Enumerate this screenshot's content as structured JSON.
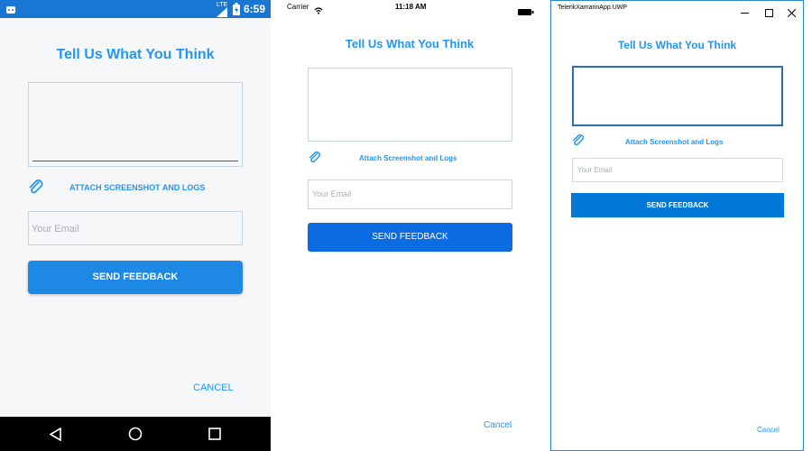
{
  "android": {
    "status": {
      "lte": "LTE",
      "time": "6:59"
    },
    "title": "Tell Us What You Think",
    "attach_label": "ATTACH SCREENSHOT AND LOGS",
    "email_placeholder": "Your Email",
    "send_label": "SEND FEEDBACK",
    "cancel_label": "CANCEL"
  },
  "ios": {
    "status": {
      "carrier": "Carrier",
      "time": "11:18 AM"
    },
    "title": "Tell Us What You Think",
    "attach_label": "Attach Screenshot and Logs",
    "email_placeholder": "Your Email",
    "send_label": "SEND FEEDBACK",
    "cancel_label": "Cancel"
  },
  "uwp": {
    "window_title": "TelerikXamarinApp.UWP",
    "title": "Tell Us What You Think",
    "attach_label": "Attach Screenshot and Logs",
    "email_placeholder": "Your Email",
    "send_label": "SEND FEEDBACK",
    "cancel_label": "Cancel"
  },
  "colors": {
    "accent": "#2196f3",
    "android_status": "#1976d2",
    "button_blue": "#1e88e5",
    "ios_button": "#0b6be0",
    "uwp_button": "#0078d7"
  }
}
